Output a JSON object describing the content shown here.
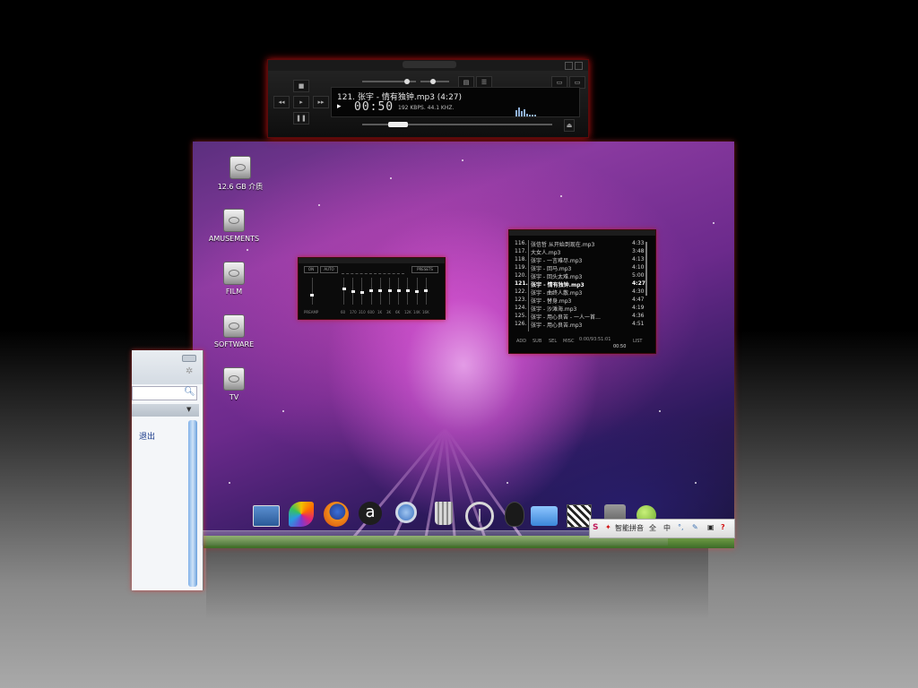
{
  "desktop": {
    "icons": [
      {
        "label": "12.6 GB 介质",
        "icon": "hard-drive-icon"
      },
      {
        "label": "AMUSEMENTS",
        "icon": "hard-drive-icon"
      },
      {
        "label": "FILM",
        "icon": "hard-drive-icon"
      },
      {
        "label": "SOFTWARE",
        "icon": "hard-drive-icon"
      },
      {
        "label": "TV",
        "icon": "hard-drive-icon"
      }
    ]
  },
  "player": {
    "track_title": "121. 张宇 - 情有独钟.mp3 (4:27)",
    "time": "00:50",
    "info": "192 KBPS. 44.1 KHZ.",
    "accent": "#e11b1b",
    "progress": 0.19
  },
  "equalizer": {
    "buttons": [
      "ON",
      "AUTO",
      "PRESETS"
    ],
    "preamp_label": "PREAMP",
    "band_labels": [
      "60",
      "170",
      "310",
      "600",
      "1K",
      "3K",
      "6K",
      "12K",
      "14K",
      "16K"
    ],
    "levels": [
      0.6,
      0.5,
      0.45,
      0.55,
      0.55,
      0.55,
      0.55,
      0.55,
      0.5,
      0.55
    ]
  },
  "playlist": {
    "rows": [
      {
        "n": "116.",
        "t": "张信哲 从开始到现在.mp3",
        "d": "4:33"
      },
      {
        "n": "117.",
        "t": "大女人.mp3",
        "d": "3:48"
      },
      {
        "n": "118.",
        "t": "张宇 - 一言难尽.mp3",
        "d": "4:13"
      },
      {
        "n": "119.",
        "t": "张宇 - 回马.mp3",
        "d": "4:10"
      },
      {
        "n": "120.",
        "t": "张宇 - 回头太难.mp3",
        "d": "5:00"
      },
      {
        "n": "121.",
        "t": "张宇 - 情有独钟.mp3",
        "d": "4:27",
        "active": true
      },
      {
        "n": "122.",
        "t": "张宇 - 曲终人散.mp3",
        "d": "4:30"
      },
      {
        "n": "123.",
        "t": "张宇 - 替身.mp3",
        "d": "4:47"
      },
      {
        "n": "124.",
        "t": "张宇 - 沙滩海.mp3",
        "d": "4:19"
      },
      {
        "n": "125.",
        "t": "张宇 - 用心良苦 - 一人一首…",
        "d": "4:36"
      },
      {
        "n": "126.",
        "t": "张宇 - 用心良苦.mp3",
        "d": "4:51"
      }
    ],
    "footer": {
      "buttons": [
        "ADD",
        "SUB",
        "SEL",
        "MISC",
        "LIST"
      ],
      "total": "0:00/93:51:01",
      "time": "00:50"
    }
  },
  "left_window": {
    "exit_label": "退出"
  },
  "dock": {
    "items": [
      {
        "icon": "desktop-icon",
        "color": "#3a6fb0"
      },
      {
        "icon": "colorful-app-icon",
        "color": "#e0a030"
      },
      {
        "icon": "firefox-icon",
        "color": "#e8661a"
      },
      {
        "icon": "amazon-icon",
        "color": "#222222"
      },
      {
        "icon": "magnifier-icon",
        "color": "#4a7fc0"
      },
      {
        "icon": "trash-icon",
        "color": "#9a9a9a"
      },
      {
        "icon": "power-icon",
        "color": "#bbbbbb"
      },
      {
        "icon": "gnome-foot-icon",
        "color": "#222222"
      },
      {
        "icon": "folder-icon",
        "color": "#4f9ae8"
      },
      {
        "icon": "clapperboard-icon",
        "color": "#2a2a2a"
      },
      {
        "icon": "package-icon",
        "color": "#888888"
      },
      {
        "icon": "fruit-icon",
        "color": "#7bbf3a"
      }
    ]
  },
  "ime": {
    "name": "智能拼音",
    "full": "全",
    "cn": "中"
  }
}
